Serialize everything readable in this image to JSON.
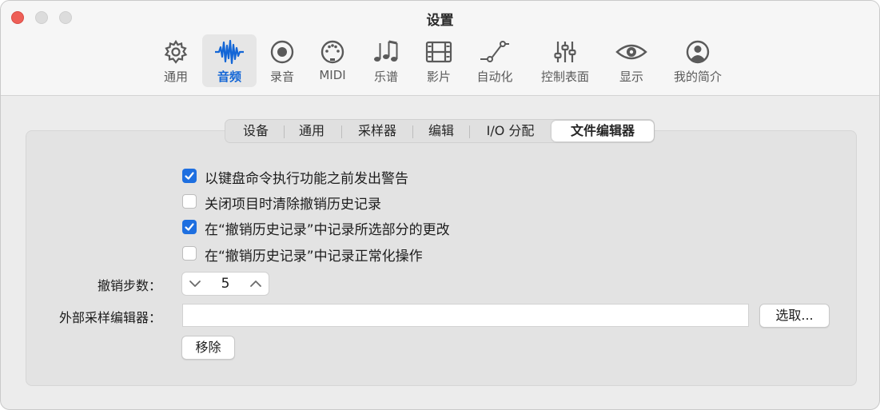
{
  "window": {
    "title": "设置"
  },
  "toolbar": {
    "items": [
      {
        "label": "通用",
        "icon": "gear-icon"
      },
      {
        "label": "音频",
        "icon": "waveform-icon",
        "active": true
      },
      {
        "label": "录音",
        "icon": "record-icon"
      },
      {
        "label": "MIDI",
        "icon": "midi-icon"
      },
      {
        "label": "乐谱",
        "icon": "notes-icon"
      },
      {
        "label": "影片",
        "icon": "film-icon"
      },
      {
        "label": "自动化",
        "icon": "automation-icon"
      },
      {
        "label": "控制表面",
        "icon": "sliders-icon"
      },
      {
        "label": "显示",
        "icon": "eye-icon"
      },
      {
        "label": "我的简介",
        "icon": "profile-icon"
      }
    ],
    "accent_color": "#1366d6"
  },
  "tabs": [
    "设备",
    "通用",
    "采样器",
    "编辑",
    "I/O 分配",
    "文件编辑器"
  ],
  "active_tab": "文件编辑器",
  "options": [
    {
      "label": "以键盘命令执行功能之前发出警告",
      "checked": true
    },
    {
      "label": "关闭项目时清除撤销历史记录",
      "checked": false
    },
    {
      "label": "在“撤销历史记录”中记录所选部分的更改",
      "checked": true
    },
    {
      "label": "在“撤销历史记录”中记录正常化操作",
      "checked": false
    }
  ],
  "undo_steps": {
    "label": "撤销步数：",
    "value": "5"
  },
  "external_editor": {
    "label": "外部采样编辑器：",
    "value": "",
    "choose_label": "选取...",
    "remove_label": "移除"
  }
}
